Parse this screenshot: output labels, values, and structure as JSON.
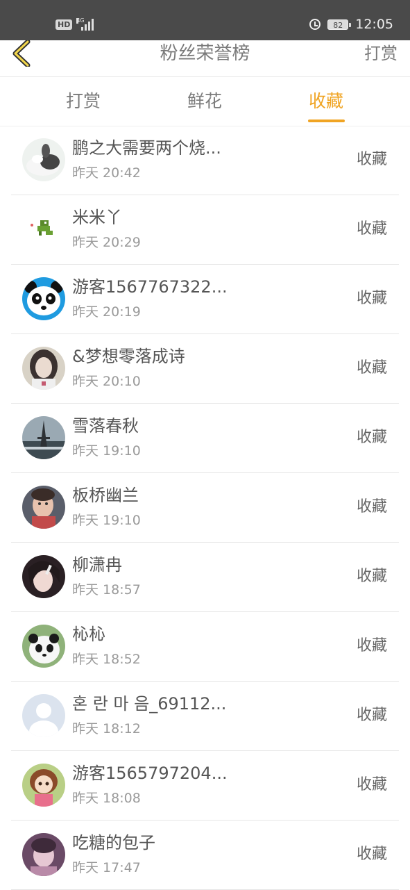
{
  "status_bar": {
    "hd_label": "HD",
    "network": "4G",
    "battery": "82",
    "time": "12:05"
  },
  "navbar": {
    "back_icon": "chevron-left-icon",
    "title": "粉丝荣誉榜",
    "right_action": "打赏",
    "accent_color": "#f0a423"
  },
  "tabs": [
    {
      "label": "打赏"
    },
    {
      "label": "鲜花"
    },
    {
      "label": "收藏",
      "active": true
    }
  ],
  "list": [
    {
      "name": "鹏之大需要两个烧...",
      "time": "昨天 20:42",
      "action": "收藏"
    },
    {
      "name": "米米丫",
      "time": "昨天 20:29",
      "action": "收藏"
    },
    {
      "name": "游客1567767322...",
      "time": "昨天 20:19",
      "action": "收藏"
    },
    {
      "name": "&梦想零落成诗",
      "time": "昨天 20:10",
      "action": "收藏"
    },
    {
      "name": "雪落春秋",
      "time": "昨天 19:10",
      "action": "收藏"
    },
    {
      "name": "板桥幽兰",
      "time": "昨天 19:10",
      "action": "收藏"
    },
    {
      "name": "柳潇冉",
      "time": "昨天 18:57",
      "action": "收藏"
    },
    {
      "name": "杺杺",
      "time": "昨天 18:52",
      "action": "收藏"
    },
    {
      "name": "혼 란 마 음_69112...",
      "time": "昨天 18:12",
      "action": "收藏"
    },
    {
      "name": "游客1565797204...",
      "time": "昨天 18:08",
      "action": "收藏"
    },
    {
      "name": "吃糖的包子",
      "time": "昨天 17:47",
      "action": "收藏"
    }
  ]
}
